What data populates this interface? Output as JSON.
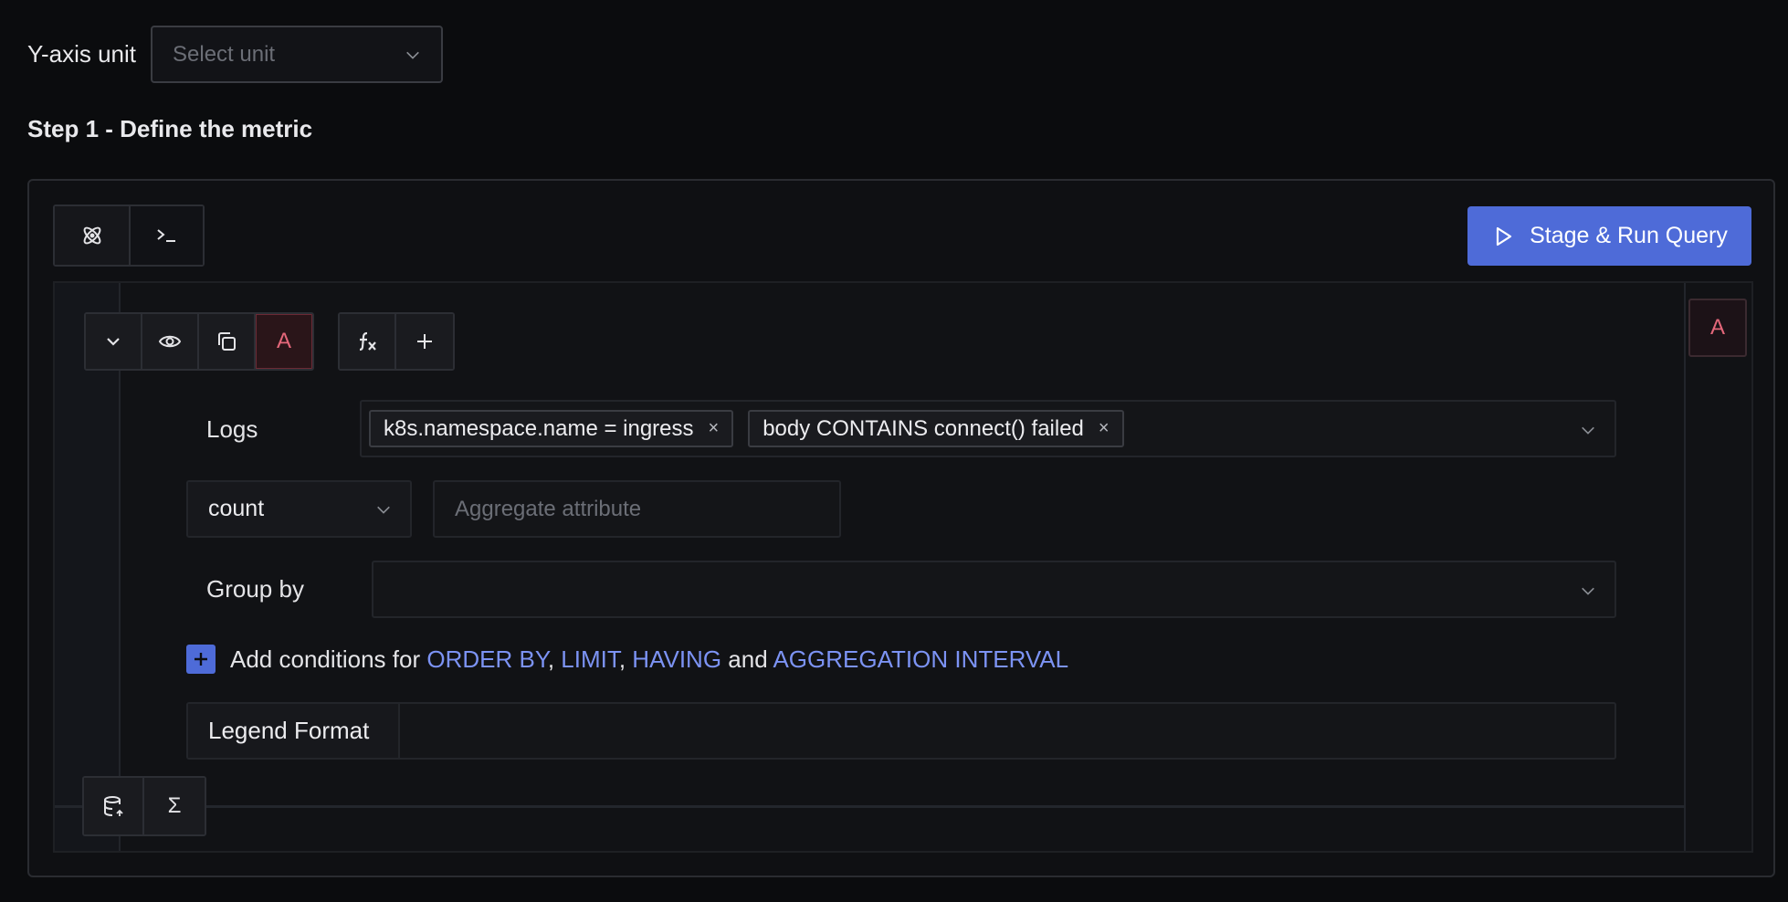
{
  "yaxis": {
    "label": "Y-axis unit",
    "placeholder": "Select unit"
  },
  "step": {
    "title": "Step 1 - Define the metric"
  },
  "mode_tabs": {
    "builder_icon": "atom-icon",
    "code_icon": "terminal-icon"
  },
  "run_button": {
    "label": "Stage & Run Query",
    "icon": "play-icon"
  },
  "query": {
    "letter": "A",
    "rail_letter": "A",
    "toolbar_icons": [
      "chevron-down-icon",
      "eye-icon",
      "copy-icon",
      "function-icon",
      "plus-icon"
    ],
    "datasource_label": "Logs",
    "filters": [
      {
        "text": "k8s.namespace.name = ingress"
      },
      {
        "text": "body CONTAINS connect() failed"
      }
    ],
    "remove_glyph": "×",
    "aggregate_op": "count",
    "aggregate_attr_placeholder": "Aggregate attribute",
    "group_by_label": "Group by",
    "conditions": {
      "prefix": "Add conditions for ",
      "order_by": "ORDER BY",
      "sep1": ", ",
      "limit": "LIMIT",
      "sep2": ", ",
      "having": "HAVING",
      "and": " and ",
      "interval": "AGGREGATION INTERVAL"
    },
    "legend_label": "Legend Format"
  },
  "bottom_tools": {
    "icons": [
      "database-icon",
      "sigma-icon"
    ],
    "sigma_glyph": "Σ"
  },
  "colors": {
    "accent": "#4e6bd8",
    "keyword": "#7c93f4",
    "query_tag": "#e4677a",
    "background": "#0b0c0e"
  }
}
